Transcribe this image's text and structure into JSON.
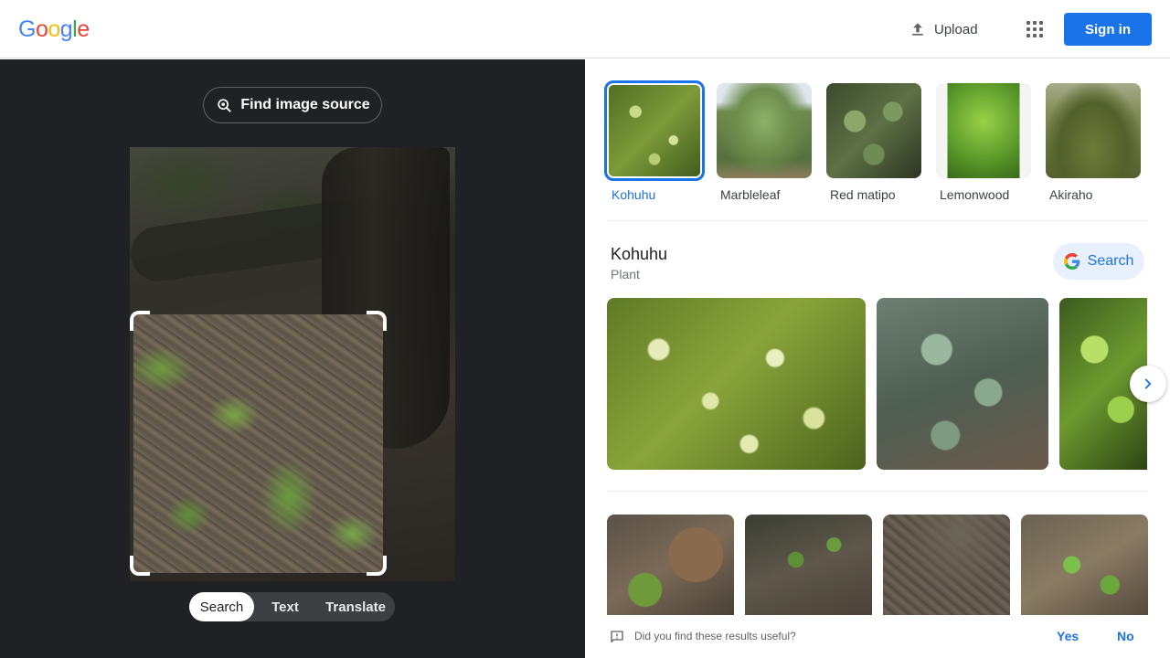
{
  "header": {
    "logo_letters": [
      {
        "char": "G",
        "color": "#4285F4"
      },
      {
        "char": "o",
        "color": "#EA4335"
      },
      {
        "char": "o",
        "color": "#FBBC05"
      },
      {
        "char": "g",
        "color": "#4285F4"
      },
      {
        "char": "l",
        "color": "#34A853"
      },
      {
        "char": "e",
        "color": "#EA4335"
      }
    ],
    "upload_label": "Upload",
    "upload_icon": "upload-icon",
    "apps_icon": "apps-grid-icon",
    "signin_label": "Sign in"
  },
  "left_panel": {
    "find_source_label": "Find image source",
    "find_source_icon": "image-search-icon",
    "modes": [
      {
        "label": "Search",
        "active": true
      },
      {
        "label": "Text",
        "active": false
      },
      {
        "label": "Translate",
        "active": false
      }
    ]
  },
  "results": {
    "suggestions": [
      {
        "label": "Kohuhu",
        "selected": true
      },
      {
        "label": "Marbleleaf",
        "selected": false
      },
      {
        "label": "Red matipo",
        "selected": false
      },
      {
        "label": "Lemonwood",
        "selected": false
      },
      {
        "label": "Akiraho",
        "selected": false
      }
    ],
    "entity": {
      "title": "Kohuhu",
      "subtitle": "Plant",
      "search_label": "Search"
    },
    "feedback": {
      "question": "Did you find these results useful?",
      "yes": "Yes",
      "no": "No"
    }
  },
  "colors": {
    "accent": "#1a73e8",
    "dark_panel": "#202124"
  }
}
